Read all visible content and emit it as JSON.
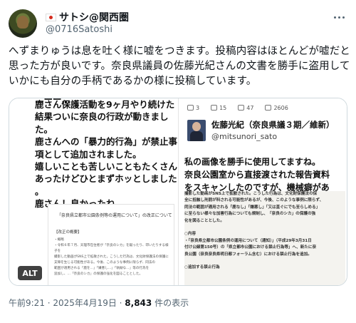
{
  "author": {
    "display_name": "サトシ@関西圏",
    "handle": "@0716Satoshi",
    "flag": "🇯🇵"
  },
  "icons": {
    "more": "more-horizontal-icon",
    "avatar": "avatar-deer"
  },
  "tweet": {
    "text": "へずまりゅうは息を吐く様に嘘をつきます。投稿内容はほとんどが嘘だと思った方が良いです。奈良県議員の佐藤光紀さんの文書を勝手に盗用していかにも自分の手柄であるかの様に投稿しています。"
  },
  "media": {
    "alt_label": "ALT",
    "left_text_cut": "…ーー…",
    "left_text": [
      "鹿さん保護活動を9ヶ月やり続けた",
      "結果ついに奈良の行政が動きまし",
      "た。",
      "鹿さんへの「暴力的行為」が禁止事",
      "項として追加されました。",
      "嬉しいことも苦しいこともたくさん",
      "あったけどひとまずホッとしました",
      "。",
      "鹿さん！良かったね。"
    ],
    "left_doc_title": "「奈良県立都市公園条例等の運用について」の改正について",
    "left_doc_sub": "【改正の概要】",
    "left_doc_lines": [
      "・概略",
      "・令和６年７月、天理市在住者が「奈良のシカ」を蹴ったり、叩いたりする様子を",
      "撮影した動画がSNS上で拡散された。こうした行為は、文化財保護法の保護に",
      "支障を生じる可能性がある。今後、このような事例に限らず、同法の",
      "範囲が適用される「鹿を…」「嫌悪し…」「執拗な…」等の行為を",
      "追加し、…「奈良のシカ」の保護の強化を図ることとした。"
    ],
    "right_stats": [
      "3",
      "15",
      "47",
      "2606"
    ],
    "right_author_name": "佐藤光紀（奈良県議３期／維新）",
    "right_author_handle": "@mitsunori_sato",
    "right_body": [
      "私の画像を勝手に使用してますね。",
      "奈良公園室から直接渡された報告資料",
      "をスキャンしたのですが、機械癖があ"
    ],
    "right_doc_lines": [
      "撮影した動画がSNS上で拡散された。こうした行為は、文化財保護法の保",
      "全に抵触し刑罰が科される可能性があるが、今後、このような事例に限らず、",
      "同法の範囲が適用される「鹿なし」「嫌悪し」「又は直ぐにでも至らしめる」",
      "に至らない様々な加害行為についても規制し、「奈良のシカ」の保護の強",
      "化を図ることとした。",
      "",
      "○内容",
      "・「奈良県立都市公園条例の運用について（通知）」（平成29年3月31日",
      "付け公緑第150号）の「県立都市公園における禁止行為等」へ、新たに奈",
      "良公園（奈良奈良県明日都フォーラム含む）における禁止行為を追加。",
      "",
      "○追加する禁止行為"
    ]
  },
  "meta": {
    "timestamp": "午前9:21 · 2025年4月19日 · ",
    "views_count": "8,843",
    "views_label": " 件の表示"
  }
}
